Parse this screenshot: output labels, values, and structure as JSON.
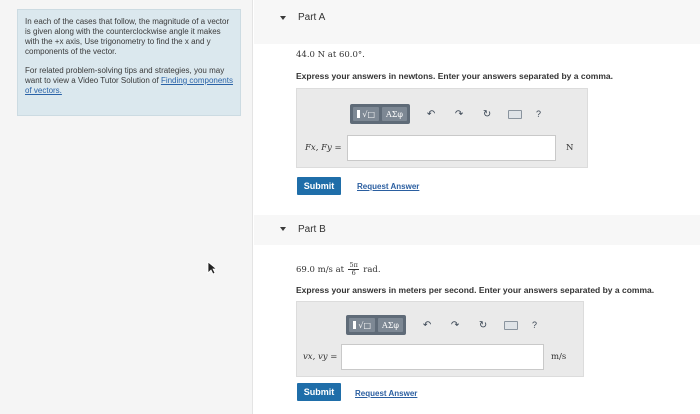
{
  "hint": {
    "paragraph1": "In each of the cases that follow, the magnitude of a vector is given along with the counterclockwise angle it makes with the +x axis, Use trigonometry to find the x and y components of the vector.",
    "paragraph2_prefix": "For related problem-solving tips and strategies, you may want to view a Video Tutor Solution of ",
    "paragraph2_link": "Finding components of vectors."
  },
  "partA": {
    "title": "Part A",
    "problem": "44.0 N at 60.0°.",
    "instruction": "Express your answers in newtons. Enter your answers separated by a comma.",
    "var_label": "Fx, Fy =",
    "input_value": "",
    "unit": "N",
    "submit_label": "Submit",
    "request_label": "Request Answer"
  },
  "partB": {
    "title": "Part B",
    "problem_prefix": "69.0 m/s at",
    "problem_numerator": "5π",
    "problem_denominator": "6",
    "problem_suffix": "rad.",
    "instruction": "Express your answers in meters per second. Enter your answers separated by a comma.",
    "var_label": "vx, vy =",
    "input_value": "",
    "unit": "m/s",
    "submit_label": "Submit",
    "request_label": "Request Answer"
  },
  "toolbar": {
    "template_label": "√□",
    "greek_label": "ΑΣφ",
    "help_label": "?"
  },
  "icons": [
    "undo-icon",
    "redo-icon",
    "reset-icon",
    "keyboard-icon",
    "help-icon"
  ],
  "colors": {
    "submit": "#1f6ea9",
    "link": "#2a63a8",
    "hint_bg": "#dbe8ee"
  }
}
